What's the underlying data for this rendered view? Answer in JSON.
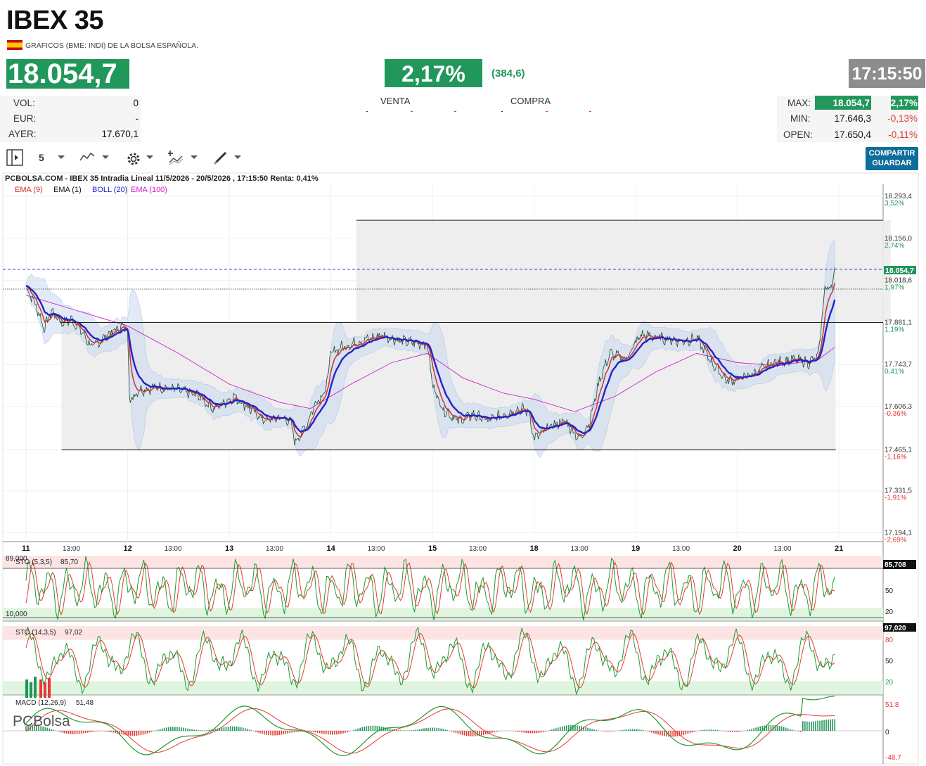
{
  "header": {
    "title": "IBEX 35",
    "subtitle": "GRÁFICOS (BME: INDI) DE LA BOLSA ESPAÑOLA.",
    "price": "18.054,7",
    "change_pct": "2,17%",
    "change_abs": "(384,6)",
    "time": "17:15:50"
  },
  "stats_left": [
    {
      "label": "VOL:",
      "value": "0"
    },
    {
      "label": "EUR:",
      "value": "-"
    },
    {
      "label": "AYER:",
      "value": "17.670,1"
    }
  ],
  "orderbook": {
    "sell_label": "VENTA",
    "buy_label": "COMPRA"
  },
  "stats_right": [
    {
      "label": "MAX:",
      "value": "18.054,7",
      "pct": "2,17%"
    },
    {
      "label": "MIN:",
      "value": "17.646,3",
      "pct": "-0,13%"
    },
    {
      "label": "OPEN:",
      "value": "17.650,4",
      "pct": "-0,11%"
    }
  ],
  "toolbar": {
    "period": "5",
    "share_label": "COMPARTIR",
    "save_label": "GUARDAR"
  },
  "colors": {
    "up": "#22975c",
    "down": "#e53935",
    "ema9": "#d32f2f",
    "boll": "#2323c8",
    "ema100": "#d020c8",
    "band": "#c9d8ee"
  },
  "chart_data": {
    "type": "line",
    "title": "PCBOLSA.COM - IBEX 35 Intradia Lineal 11/5/2026 - 20/5/2026 , 17:15:50 Renta: 0,41%",
    "legend": [
      "EMA (9)",
      "EMA (1)",
      "BOLL (20)",
      "EMA (100)"
    ],
    "x_day_labels": [
      "11",
      "12",
      "13",
      "14",
      "15",
      "18",
      "19",
      "20",
      "21"
    ],
    "x_hour_label": "13:00",
    "y_ticks": [
      {
        "v": "18.293,4",
        "p": "3,52%"
      },
      {
        "v": "18.156,0",
        "p": "2,74%"
      },
      {
        "v": "18.018,6",
        "p": "1,97%"
      },
      {
        "v": "17.881,1",
        "p": "1,19%"
      },
      {
        "v": "17.743,7",
        "p": "0,41%"
      },
      {
        "v": "17.606,3",
        "p": "-0,36%"
      },
      {
        "v": "17.465,1",
        "p": "-1,16%"
      },
      {
        "v": "17.331,5",
        "p": "-1,91%"
      },
      {
        "v": "17.194,1",
        "p": "-2,69%"
      }
    ],
    "last_label": "18.054,7",
    "ylim": [
      17170,
      18330
    ],
    "price_series": [
      {
        "d": 0,
        "v": 18000
      },
      {
        "d": 0.1,
        "v": 17935
      },
      {
        "d": 0.18,
        "v": 17860
      },
      {
        "d": 0.25,
        "v": 17920
      },
      {
        "d": 0.35,
        "v": 17880
      },
      {
        "d": 0.45,
        "v": 17890
      },
      {
        "d": 0.55,
        "v": 17850
      },
      {
        "d": 0.65,
        "v": 17800
      },
      {
        "d": 0.8,
        "v": 17840
      },
      {
        "d": 0.95,
        "v": 17870
      },
      {
        "d": 1.0,
        "v": 17860
      },
      {
        "d": 1.02,
        "v": 17620
      },
      {
        "d": 1.1,
        "v": 17660
      },
      {
        "d": 1.3,
        "v": 17670
      },
      {
        "d": 1.5,
        "v": 17660
      },
      {
        "d": 1.7,
        "v": 17640
      },
      {
        "d": 1.85,
        "v": 17600
      },
      {
        "d": 1.95,
        "v": 17620
      },
      {
        "d": 2.05,
        "v": 17640
      },
      {
        "d": 2.2,
        "v": 17600
      },
      {
        "d": 2.35,
        "v": 17560
      },
      {
        "d": 2.5,
        "v": 17570
      },
      {
        "d": 2.6,
        "v": 17560
      },
      {
        "d": 2.65,
        "v": 17490
      },
      {
        "d": 2.75,
        "v": 17540
      },
      {
        "d": 2.85,
        "v": 17620
      },
      {
        "d": 2.95,
        "v": 17660
      },
      {
        "d": 3.0,
        "v": 17780
      },
      {
        "d": 3.1,
        "v": 17800
      },
      {
        "d": 3.3,
        "v": 17820
      },
      {
        "d": 3.5,
        "v": 17840
      },
      {
        "d": 3.7,
        "v": 17820
      },
      {
        "d": 3.95,
        "v": 17810
      },
      {
        "d": 4.0,
        "v": 17680
      },
      {
        "d": 4.1,
        "v": 17600
      },
      {
        "d": 4.25,
        "v": 17560
      },
      {
        "d": 4.4,
        "v": 17580
      },
      {
        "d": 4.55,
        "v": 17560
      },
      {
        "d": 4.7,
        "v": 17580
      },
      {
        "d": 4.85,
        "v": 17600
      },
      {
        "d": 4.95,
        "v": 17590
      },
      {
        "d": 5.0,
        "v": 17500
      },
      {
        "d": 5.15,
        "v": 17540
      },
      {
        "d": 5.3,
        "v": 17560
      },
      {
        "d": 5.45,
        "v": 17500
      },
      {
        "d": 5.55,
        "v": 17560
      },
      {
        "d": 5.65,
        "v": 17700
      },
      {
        "d": 5.75,
        "v": 17780
      },
      {
        "d": 5.9,
        "v": 17760
      },
      {
        "d": 6.05,
        "v": 17840
      },
      {
        "d": 6.25,
        "v": 17830
      },
      {
        "d": 6.45,
        "v": 17820
      },
      {
        "d": 6.6,
        "v": 17830
      },
      {
        "d": 6.75,
        "v": 17750
      },
      {
        "d": 6.9,
        "v": 17690
      },
      {
        "d": 7.05,
        "v": 17700
      },
      {
        "d": 7.2,
        "v": 17720
      },
      {
        "d": 7.35,
        "v": 17750
      },
      {
        "d": 7.55,
        "v": 17760
      },
      {
        "d": 7.7,
        "v": 17750
      },
      {
        "d": 7.8,
        "v": 17770
      },
      {
        "d": 7.86,
        "v": 17990
      },
      {
        "d": 7.93,
        "v": 18000
      },
      {
        "d": 7.96,
        "v": 18054.7
      }
    ],
    "ema100_series": [
      {
        "d": 0,
        "v": 17970
      },
      {
        "d": 0.5,
        "v": 17920
      },
      {
        "d": 1.0,
        "v": 17870
      },
      {
        "d": 1.5,
        "v": 17780
      },
      {
        "d": 2.0,
        "v": 17680
      },
      {
        "d": 2.5,
        "v": 17620
      },
      {
        "d": 2.8,
        "v": 17600
      },
      {
        "d": 3.2,
        "v": 17680
      },
      {
        "d": 3.6,
        "v": 17750
      },
      {
        "d": 3.95,
        "v": 17780
      },
      {
        "d": 4.3,
        "v": 17700
      },
      {
        "d": 4.7,
        "v": 17650
      },
      {
        "d": 5.0,
        "v": 17630
      },
      {
        "d": 5.4,
        "v": 17590
      },
      {
        "d": 5.8,
        "v": 17640
      },
      {
        "d": 6.2,
        "v": 17720
      },
      {
        "d": 6.6,
        "v": 17780
      },
      {
        "d": 7.0,
        "v": 17750
      },
      {
        "d": 7.4,
        "v": 17740
      },
      {
        "d": 7.8,
        "v": 17760
      },
      {
        "d": 7.96,
        "v": 17800
      }
    ],
    "levels": {
      "upper": 18215,
      "mid": 17881,
      "lower": 17465,
      "yesterday": 17990,
      "last": 18054.7
    },
    "rectangles": [
      {
        "from_day": 3.25,
        "to_day": 8.51,
        "top": 18215,
        "bottom": 17881
      },
      {
        "from_day": 0.35,
        "to_day": 7.97,
        "top": 17881,
        "bottom": 17465
      }
    ],
    "sto1": {
      "label": "STO (5,3,5)",
      "value": "85,70",
      "last": "85,708",
      "top_label": "89,000",
      "bottom_label": "10,000",
      "ticks": [
        "50",
        "20"
      ]
    },
    "sto2": {
      "label": "STO (14,3,5)",
      "value": "97,02",
      "last": "97,020",
      "ticks": [
        "80",
        "50",
        "20"
      ]
    },
    "macd": {
      "label": "MACD (12,26,9)",
      "value": "51,48",
      "ticks": [
        "51,8",
        "0",
        "-48,7"
      ]
    },
    "brand": "PCBolsa"
  }
}
